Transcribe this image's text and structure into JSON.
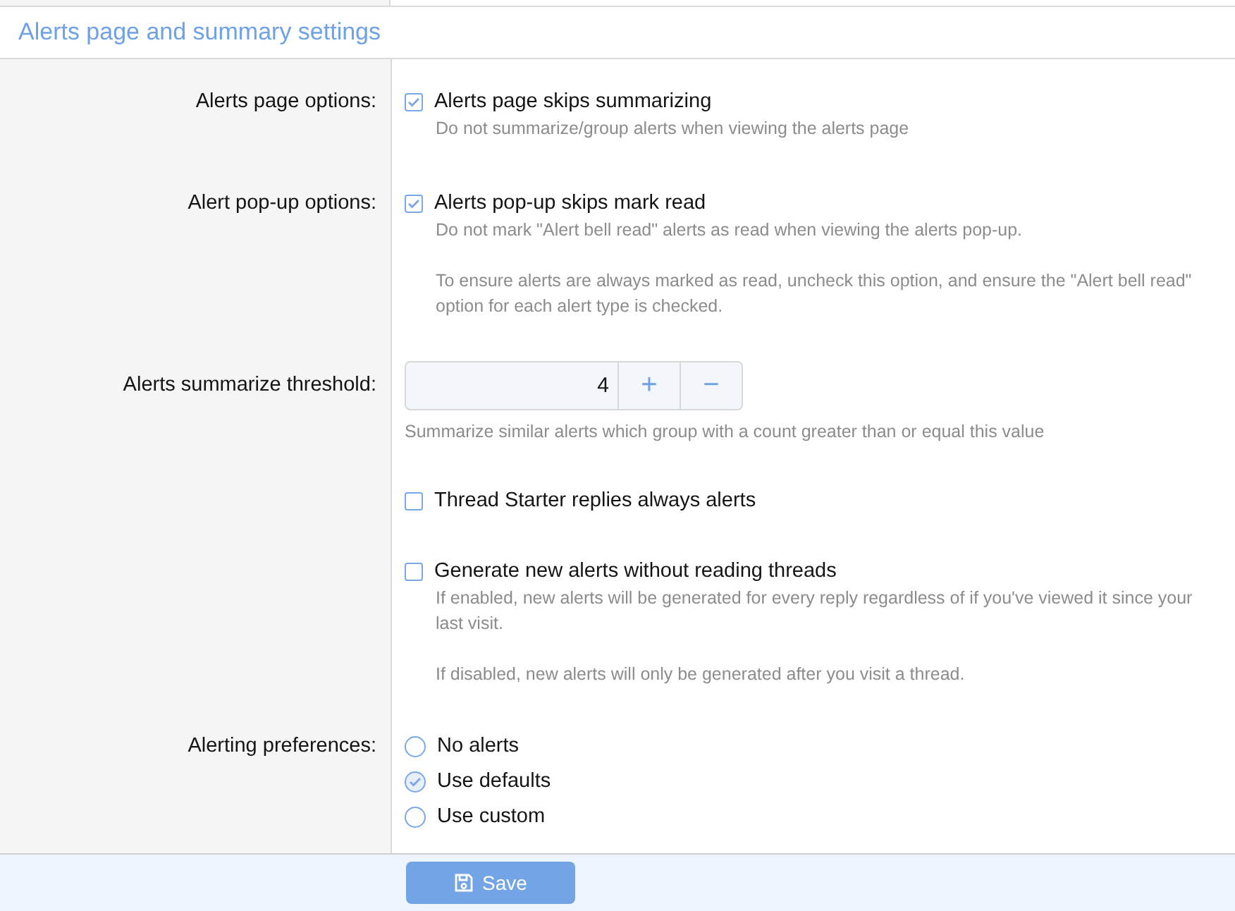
{
  "section_title": "Alerts page and summary settings",
  "rows": [
    {
      "kind": "checkbox",
      "label": "Alerts page options:",
      "option": "Alerts page skips summarizing",
      "checked": true,
      "hints": [
        "Do not summarize/group alerts when viewing the alerts page"
      ]
    },
    {
      "kind": "checkbox",
      "label": "Alert pop-up options:",
      "option": "Alerts pop-up skips mark read",
      "checked": true,
      "hints": [
        "Do not mark \"Alert bell read\" alerts as read when viewing the alerts pop-up.",
        "To ensure alerts are always marked as read, uncheck this option, and ensure the \"Alert bell read\" option for each alert type is checked."
      ]
    },
    {
      "kind": "number",
      "label": "Alerts summarize threshold:",
      "value": "4",
      "increment": "+",
      "decrement": "−",
      "hints": [
        "Summarize similar alerts which group with a count greater than or equal this value"
      ]
    },
    {
      "kind": "checkbox",
      "option": "Thread Starter replies always alerts",
      "checked": false
    },
    {
      "kind": "checkbox",
      "option": "Generate new alerts without reading threads",
      "checked": false,
      "hints": [
        "If enabled, new alerts will be generated for every reply regardless of if you've viewed it since your last visit.",
        "If disabled, new alerts will only be generated after you visit a thread."
      ]
    },
    {
      "kind": "radio",
      "label": "Alerting preferences:",
      "choices": [
        {
          "label": "No alerts",
          "selected": false
        },
        {
          "label": "Use defaults",
          "selected": true
        },
        {
          "label": "Use custom",
          "selected": false
        }
      ]
    }
  ],
  "save_button": "Save"
}
